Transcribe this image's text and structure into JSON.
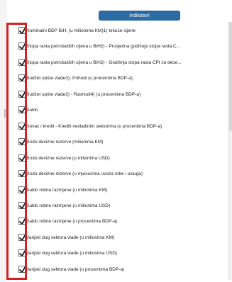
{
  "header": {
    "title": "Indikatori"
  },
  "items": [
    {
      "label": "Nominalni BDP BiH, (u milionima KM)1) tekuće cijene",
      "checked": true
    },
    {
      "label": "Stopa rasta potrošačkih cijena u BiH2) - Prosječna godišnja stopa rasta C...",
      "checked": true
    },
    {
      "label": "Stopa rasta potrošačkih cijena u BiH2) - Godišnja stopa rasta CPI za dece...",
      "checked": true
    },
    {
      "label": "Budžet opšte vlade3)- Prihodi (u procentima BDP-a)",
      "checked": true
    },
    {
      "label": "Budžet opšte vlade3) - Rashodi4) (u procentima BDP-a)",
      "checked": true
    },
    {
      "label": "Saldo",
      "checked": true
    },
    {
      "label": "Novac i kredit - Krediti nevladinim sektorima (u procentima BDP-a)",
      "checked": true
    },
    {
      "label": "Bruto devizne rezerve (milionima KM)",
      "checked": true
    },
    {
      "label": "Bruto devizne rezerve (u milionima USD)",
      "checked": true
    },
    {
      "label": "Bruto devizne rezerve (u mjesecima uvoza robe i usluga)",
      "checked": true
    },
    {
      "label": "Saldo robne razmjene (u milionima KM)",
      "checked": true
    },
    {
      "label": "Saldo robne razmjene (u milionima USD)",
      "checked": true
    },
    {
      "label": "Saldo robne razmjene (u procentima BDP-a)",
      "checked": true
    },
    {
      "label": "Vanjski dug sektora vlade (u milionima KM)",
      "checked": true
    },
    {
      "label": "Vanjski dug sektora vlade (u milionima USD)",
      "checked": true
    },
    {
      "label": "Vanjski dug sektora vlade (u procentima BDP-a)",
      "checked": true
    }
  ],
  "colors": {
    "header_bg": "#2a6ca3",
    "highlight_border": "#d61f1f",
    "text": "#222222"
  }
}
